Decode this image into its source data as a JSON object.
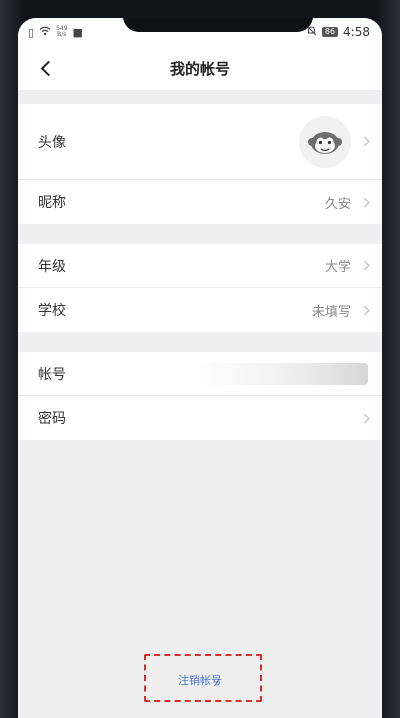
{
  "status_bar": {
    "net_speed_value": "549",
    "net_speed_unit": "B/s",
    "battery": "86",
    "time": "4:58"
  },
  "nav": {
    "title": "我的帐号"
  },
  "section_profile": {
    "avatar_label": "头像",
    "nickname_label": "昵称",
    "nickname_value": "久安"
  },
  "section_school": {
    "grade_label": "年级",
    "grade_value": "大学",
    "school_label": "学校",
    "school_value": "未填写"
  },
  "section_account": {
    "account_label": "帐号",
    "password_label": "密码"
  },
  "footer": {
    "logout_label": "注销帐号"
  },
  "colors": {
    "page_background": "#efefef",
    "link_blue": "#4a78d6",
    "annotation_red": "#d62c2c"
  }
}
